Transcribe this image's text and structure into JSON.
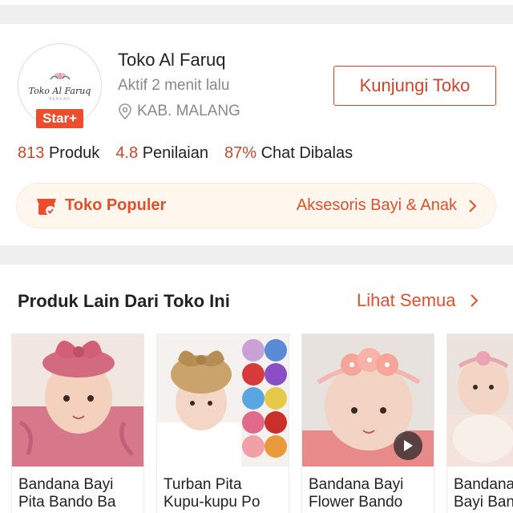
{
  "shop": {
    "logo_text": "Toko Al Faruq",
    "logo_sub": "BERKAH",
    "badge": "Star+",
    "name": "Toko Al Faruq",
    "status": "Aktif 2 menit lalu",
    "location": "KAB. MALANG",
    "visit_label": "Kunjungi Toko",
    "stats": [
      {
        "value": "813",
        "label": "Produk"
      },
      {
        "value": "4.8",
        "label": "Penilaian"
      },
      {
        "value": "87%",
        "label": "Chat Dibalas"
      }
    ],
    "popular": {
      "title": "Toko Populer",
      "category": "Aksesoris Bayi & Anak"
    }
  },
  "products_section": {
    "title": "Produk Lain Dari Toko Ini",
    "see_all": "Lihat Semua",
    "items": [
      {
        "name": "Bandana Bayi\nPita Bando Ba"
      },
      {
        "name": "Turban Pita\nKupu-kupu Po"
      },
      {
        "name": "Bandana Bayi\nFlower Bando"
      },
      {
        "name": "Bandana\nBayi Ban"
      }
    ]
  },
  "colors": {
    "accent": "#ee4d2d",
    "accent_text": "#d0452a",
    "popular_bg": "#fff6ee"
  },
  "icons": [
    "location-pin-icon",
    "shop-popular-icon",
    "chevron-right-icon",
    "play-icon",
    "flower-logo-icon"
  ]
}
